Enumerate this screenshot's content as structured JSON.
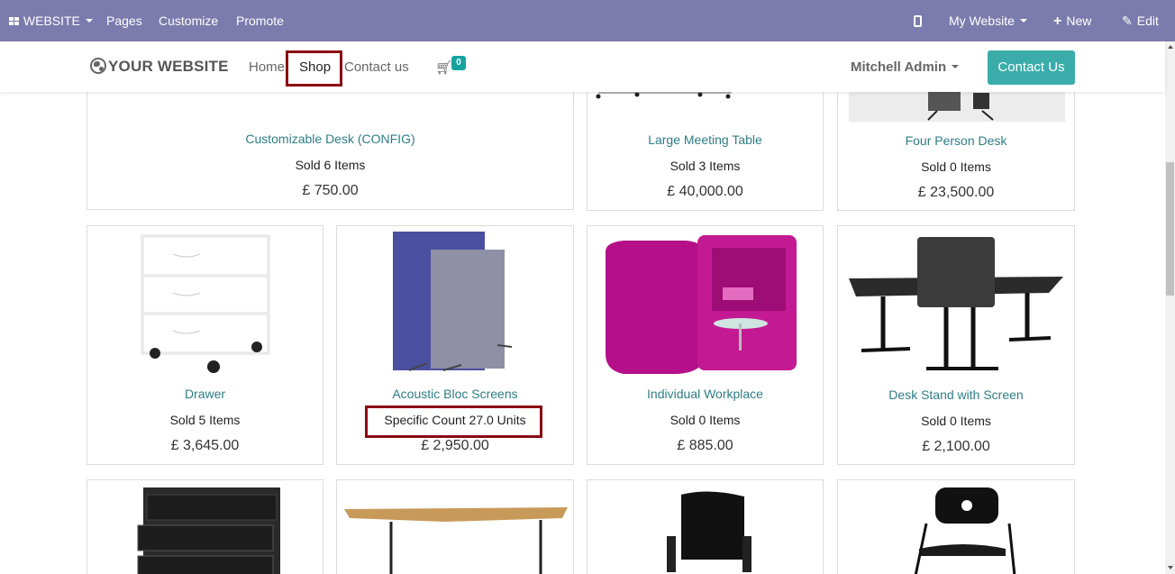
{
  "adminbar": {
    "apps_label": "WEBSITE",
    "menu": [
      "Pages",
      "Customize",
      "Promote"
    ],
    "site_selector": "My Website",
    "new_label": "New",
    "edit_label": "Edit"
  },
  "header": {
    "logo_text": "YOUR WEBSITE",
    "nav": [
      "Home",
      "Shop",
      "Contact us"
    ],
    "cart_count": "0",
    "user_name": "Mitchell Admin",
    "contact_button": "Contact Us"
  },
  "products_row1": [
    {
      "name": "Customizable Desk (CONFIG)",
      "sold": "Sold 6 Items",
      "price": "£ 750.00"
    },
    {
      "name": "Large Meeting Table",
      "sold": "Sold 3 Items",
      "price": "£ 40,000.00"
    },
    {
      "name": "Four Person Desk",
      "sold": "Sold 0 Items",
      "price": "£ 23,500.00"
    }
  ],
  "products_row2": [
    {
      "name": "Drawer",
      "sold": "Sold 5 Items",
      "price": "£ 3,645.00"
    },
    {
      "name": "Acoustic Bloc Screens",
      "sold": "Specific Count 27.0 Units",
      "price": "£ 2,950.00"
    },
    {
      "name": "Individual Workplace",
      "sold": "Sold 0 Items",
      "price": "£ 885.00"
    },
    {
      "name": "Desk Stand with Screen",
      "sold": "Sold 0 Items",
      "price": "£ 2,100.00"
    }
  ],
  "colors": {
    "admin_bar": "#7c7bad",
    "accent": "#3aadaa",
    "product_link": "#2e7d86",
    "highlight_border": "#8b0a14"
  }
}
